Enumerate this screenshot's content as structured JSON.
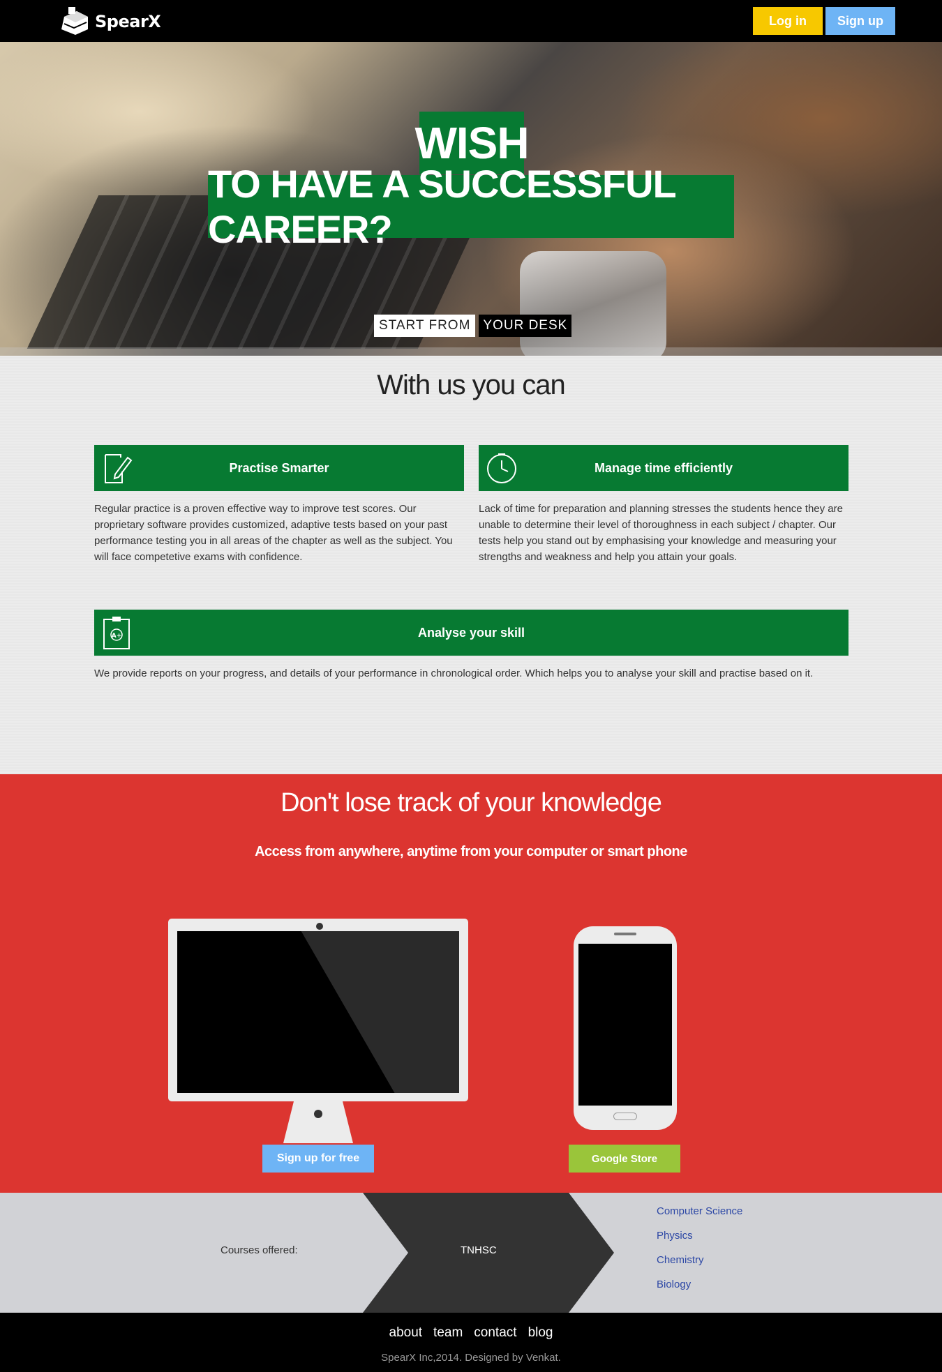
{
  "header": {
    "brand": "SpearX",
    "login_label": "Log in",
    "signup_label": "Sign up"
  },
  "hero": {
    "wish": "WISH",
    "headline": "TO HAVE A SUCCESSFUL CAREER?",
    "tag_a": "START FROM",
    "tag_b": "YOUR DESK"
  },
  "features": {
    "title": "With us you can",
    "items": [
      {
        "heading": "Practise Smarter",
        "icon": "document-pen-icon",
        "text": "Regular practice is a proven effective way to improve test scores. Our proprietary software provides customized, adaptive tests based on your past performance testing you in all areas of the chapter as well as the subject. You will face competetive exams with confidence."
      },
      {
        "heading": "Manage time efficiently",
        "icon": "clock-icon",
        "text": "Lack of time for preparation and planning stresses the students hence they are unable to determine their level of thoroughness in each subject / chapter. Our tests help you stand out by emphasising your knowledge and measuring your strengths and weakness and help you attain your goals."
      },
      {
        "heading": "Analyse your skill",
        "icon": "clipboard-grade-icon",
        "text": "We provide reports on your progress, and details of your performance in chronological order. Which helps you to analyse your skill and practise based on it."
      }
    ]
  },
  "access": {
    "title": "Don't lose track of your knowledge",
    "subtitle": "Access from anywhere, anytime from your computer or smart phone",
    "signup_free_label": "Sign up for free",
    "store_label": "Google Store"
  },
  "courses": {
    "label": "Courses offered:",
    "board": "TNHSC",
    "subjects": [
      "Computer Science",
      "Physics",
      "Chemistry",
      "Biology"
    ]
  },
  "footer": {
    "links": [
      "about",
      "team",
      "contact",
      "blog"
    ],
    "copyright": "SpearX Inc,2014. Designed by Venkat."
  },
  "colors": {
    "brand_green": "#077a32",
    "login_yellow": "#f7c800",
    "signup_blue": "#6eb4f5",
    "section_red": "#dc3530",
    "store_green": "#9ac53a",
    "link_blue": "#2c47a5"
  }
}
